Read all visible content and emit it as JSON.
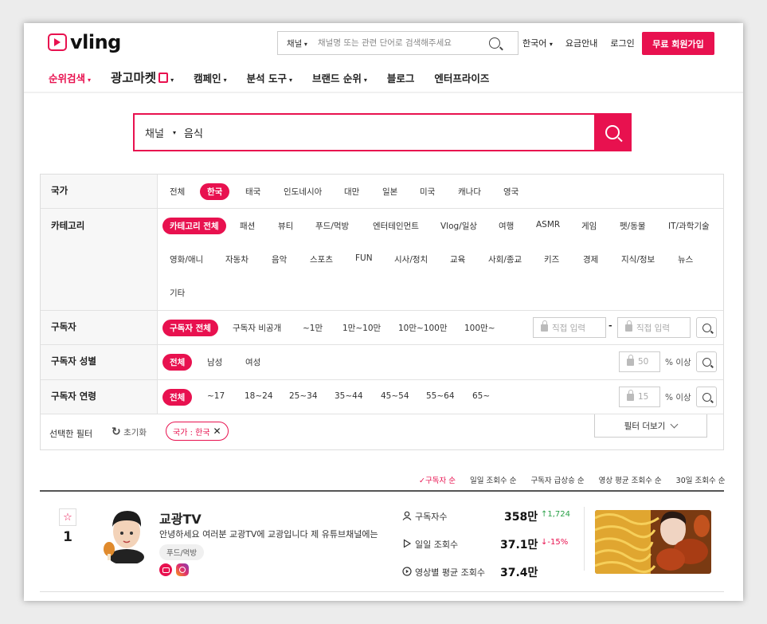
{
  "header": {
    "logo_text": "vling",
    "search": {
      "type_label": "채널",
      "placeholder": "채널명 또는 관련 단어로 검색해주세요"
    },
    "links": [
      "한국어",
      "요금안내",
      "로그인"
    ],
    "signup_label": "무료 회원가입"
  },
  "nav": {
    "items": [
      {
        "label": "순위검색",
        "dropdown": true
      },
      {
        "label": "광고마켓",
        "dropdown": true
      },
      {
        "label": "캠페인",
        "dropdown": true
      },
      {
        "label": "분석 도구",
        "dropdown": true
      },
      {
        "label": "브랜드 순위",
        "dropdown": true
      },
      {
        "label": "블로그",
        "dropdown": false
      },
      {
        "label": "엔터프라이즈",
        "dropdown": false
      }
    ],
    "caret": "▾"
  },
  "main_search": {
    "type_label": "채널",
    "value": "음식"
  },
  "filters": {
    "country": {
      "label": "국가",
      "options": [
        "전체",
        "한국",
        "태국",
        "인도네시아",
        "대만",
        "일본",
        "미국",
        "캐나다",
        "영국"
      ],
      "selected": "한국"
    },
    "category": {
      "label": "카테고리",
      "options": [
        "카테고리 전체",
        "패션",
        "뷰티",
        "푸드/먹방",
        "엔터테인먼트",
        "Vlog/일상",
        "여행",
        "ASMR",
        "게임",
        "펫/동물",
        "IT/과학기술",
        "영화/애니",
        "자동차",
        "음악",
        "스포츠",
        "FUN",
        "시사/정치",
        "교육",
        "사회/종교",
        "키즈",
        "경제",
        "지식/정보",
        "뉴스",
        "기타"
      ],
      "selected": "카테고리 전체"
    },
    "subscribers": {
      "label": "구독자",
      "options": [
        "구독자 전체",
        "구독자 비공개",
        "~1만",
        "1만~10만",
        "10만~100만",
        "100만~"
      ],
      "selected": "구독자 전체",
      "min_placeholder": "직접 입력",
      "max_placeholder": "직접 입력",
      "range_sep": "-"
    },
    "gender": {
      "label": "구독자 성별",
      "options": [
        "전체",
        "남성",
        "여성"
      ],
      "selected": "전체",
      "percent_value": "50",
      "percent_suffix": "% 이상"
    },
    "age": {
      "label": "구독자 연령",
      "options": [
        "전체",
        "~17",
        "18~24",
        "25~34",
        "35~44",
        "45~54",
        "55~64",
        "65~"
      ],
      "selected": "전체",
      "percent_value": "15",
      "percent_suffix": "% 이상"
    },
    "selected_bar": {
      "label": "선택한 필터",
      "reset_label": "초기화",
      "tags": [
        "국가 : 한국"
      ],
      "more_label": "필터 더보기"
    }
  },
  "sort": {
    "options": [
      "구독자 순",
      "일일 조회수 순",
      "구독자 급상승 순",
      "영상 평균 조회수 순",
      "30일 조회수 순"
    ],
    "selected": "구독자 순",
    "check": "✓"
  },
  "results": [
    {
      "rank": "1",
      "name": "교광TV",
      "description": "안녕하세요 여러분 교광TV에 교광입니다 제 유튜브채널에는",
      "tag": "푸드/먹방",
      "stats": {
        "subscribers": {
          "label": "구독자수",
          "value": "358만",
          "change": "↑1,724",
          "change_color": "#2aa148"
        },
        "daily_views": {
          "label": "일일 조회수",
          "value": "37.1만",
          "change": "↓-15%",
          "change_color": "#e8114f"
        },
        "avg_views": {
          "label": "영상별 평균 조회수",
          "value": "37.4만"
        }
      }
    }
  ],
  "colors": {
    "accent": "#e8114f"
  }
}
